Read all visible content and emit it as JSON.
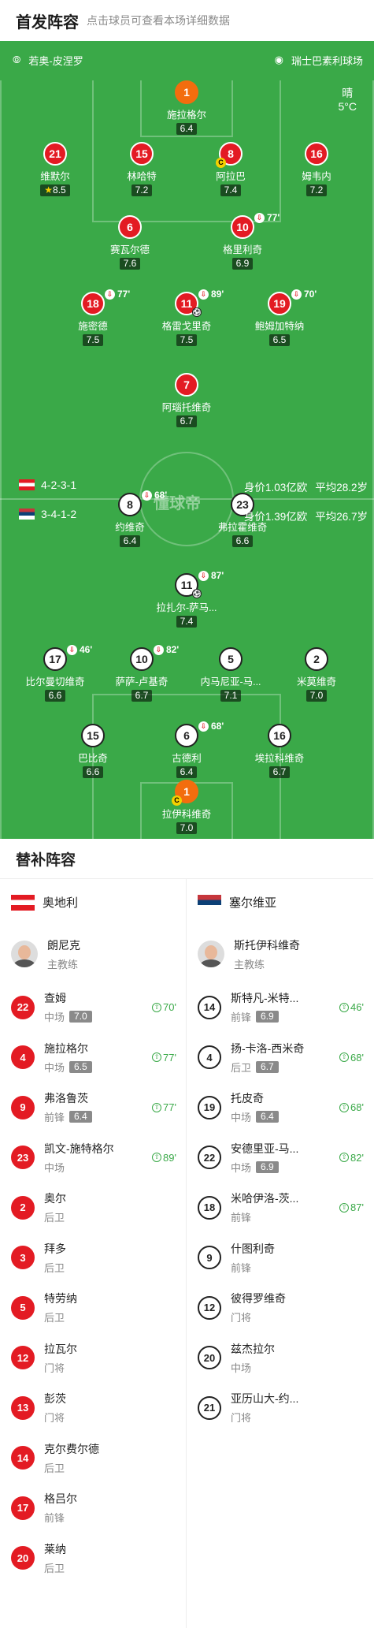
{
  "header": {
    "title": "首发阵容",
    "subtitle": "点击球员可查看本场详细数据"
  },
  "pitch": {
    "referee": "若奥-皮涅罗",
    "stadium": "瑞士巴素利球场",
    "weather": "晴",
    "temperature": "5°C",
    "watermark": "懂球帝",
    "home_formation": "4-2-3-1",
    "away_formation": "3-4-1-2",
    "home_value": "身价1.03亿欧",
    "home_age": "平均28.2岁",
    "away_value": "身价1.39亿欧",
    "away_age": "平均26.7岁"
  },
  "home_players": [
    {
      "num": "1",
      "name": "施拉格尔",
      "rating": "6.4",
      "style": "ora"
    },
    {
      "num": "21",
      "name": "维默尔",
      "rating": "8.5",
      "star": "★"
    },
    {
      "num": "15",
      "name": "林哈特",
      "rating": "7.2"
    },
    {
      "num": "8",
      "name": "阿拉巴",
      "rating": "7.4",
      "captain": "C"
    },
    {
      "num": "16",
      "name": "姆韦内",
      "rating": "7.2"
    },
    {
      "num": "6",
      "name": "赛瓦尔德",
      "rating": "7.6"
    },
    {
      "num": "10",
      "name": "格里利奇",
      "rating": "6.9",
      "sub_min": "77'"
    },
    {
      "num": "18",
      "name": "施密德",
      "rating": "7.5",
      "sub_min": "77'"
    },
    {
      "num": "11",
      "name": "格雷戈里奇",
      "rating": "7.5",
      "sub_min": "89'",
      "goal": "⚽"
    },
    {
      "num": "19",
      "name": "鲍姆加特纳",
      "rating": "6.5",
      "sub_min": "70'"
    },
    {
      "num": "7",
      "name": "阿瑙托维奇",
      "rating": "6.7"
    }
  ],
  "away_players": [
    {
      "num": "8",
      "name": "约维奇",
      "rating": "6.4",
      "sub_min": "68'"
    },
    {
      "num": "23",
      "name": "弗拉霍维奇",
      "rating": "6.6"
    },
    {
      "num": "11",
      "name": "拉扎尔-萨马...",
      "rating": "7.4",
      "sub_min": "87'",
      "goal": "⚽"
    },
    {
      "num": "17",
      "name": "比尔曼切维奇",
      "rating": "6.6",
      "sub_min": "46'"
    },
    {
      "num": "10",
      "name": "萨萨-卢基奇",
      "rating": "6.7",
      "sub_min": "82'"
    },
    {
      "num": "5",
      "name": "内马尼亚-马...",
      "rating": "7.1"
    },
    {
      "num": "2",
      "name": "米莫维奇",
      "rating": "7.0"
    },
    {
      "num": "15",
      "name": "巴比奇",
      "rating": "6.6"
    },
    {
      "num": "6",
      "name": "古德利",
      "rating": "6.4",
      "sub_min": "68'"
    },
    {
      "num": "16",
      "name": "埃拉科维奇",
      "rating": "6.7"
    },
    {
      "num": "1",
      "name": "拉伊科维奇",
      "rating": "7.0",
      "style": "ora",
      "captain": "C"
    }
  ],
  "bench": {
    "title": "替补阵容",
    "home": {
      "team": "奥地利",
      "coach": {
        "name": "朗尼克",
        "role": "主教练"
      },
      "players": [
        {
          "num": "22",
          "name": "查姆",
          "pos": "中场",
          "rating": "7.0",
          "sub_min": "70'"
        },
        {
          "num": "4",
          "name": "施拉格尔",
          "pos": "中场",
          "rating": "6.5",
          "sub_min": "77'"
        },
        {
          "num": "9",
          "name": "弗洛鲁茨",
          "pos": "前锋",
          "rating": "6.4",
          "sub_min": "77'"
        },
        {
          "num": "23",
          "name": "凯文-施特格尔",
          "pos": "中场",
          "rating": "",
          "sub_min": "89'"
        },
        {
          "num": "2",
          "name": "奥尔",
          "pos": "后卫"
        },
        {
          "num": "3",
          "name": "拜多",
          "pos": "后卫"
        },
        {
          "num": "5",
          "name": "特劳纳",
          "pos": "后卫"
        },
        {
          "num": "12",
          "name": "拉瓦尔",
          "pos": "门将"
        },
        {
          "num": "13",
          "name": "彭茨",
          "pos": "门将"
        },
        {
          "num": "14",
          "name": "克尔费尔德",
          "pos": "后卫"
        },
        {
          "num": "17",
          "name": "格吕尔",
          "pos": "前锋"
        },
        {
          "num": "20",
          "name": "莱纳",
          "pos": "后卫"
        }
      ]
    },
    "away": {
      "team": "塞尔维亚",
      "coach": {
        "name": "斯托伊科维奇",
        "role": "主教练"
      },
      "players": [
        {
          "num": "14",
          "name": "斯特凡-米特...",
          "pos": "前锋",
          "rating": "6.9",
          "sub_min": "46'"
        },
        {
          "num": "4",
          "name": "扬-卡洛-西米奇",
          "pos": "后卫",
          "rating": "6.7",
          "sub_min": "68'"
        },
        {
          "num": "19",
          "name": "托皮奇",
          "pos": "中场",
          "rating": "6.4",
          "sub_min": "68'"
        },
        {
          "num": "22",
          "name": "安德里亚-马...",
          "pos": "中场",
          "rating": "6.9",
          "sub_min": "82'"
        },
        {
          "num": "18",
          "name": "米哈伊洛-茨...",
          "pos": "前锋",
          "rating": "",
          "sub_min": "87'"
        },
        {
          "num": "9",
          "name": "什图利奇",
          "pos": "前锋"
        },
        {
          "num": "12",
          "name": "彼得罗维奇",
          "pos": "门将"
        },
        {
          "num": "20",
          "name": "兹杰拉尔",
          "pos": "中场"
        },
        {
          "num": "21",
          "name": "亚历山大-约...",
          "pos": "门将"
        }
      ]
    }
  },
  "colors": {
    "pitch": "#3aa948",
    "home": "#e31b23",
    "keeper": "#f36d0e",
    "away": "#ffffff"
  }
}
